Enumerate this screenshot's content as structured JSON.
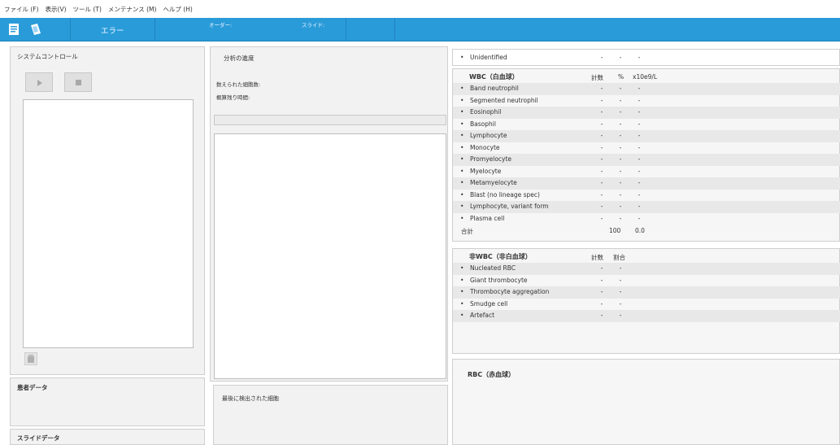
{
  "menu": [
    "ファイル (F)",
    "表示(V)",
    "ツール (T)",
    "メンテナンス (M)",
    "ヘルプ (H)"
  ],
  "toolbar": {
    "error_label": "エラー",
    "order_label": "オーダー:",
    "slide_label": "スライド:"
  },
  "system_control": {
    "title": "システムコントロール"
  },
  "patient_data": {
    "title": "患者データ"
  },
  "slide_data": {
    "title": "スライドデータ"
  },
  "analysis": {
    "title": "分析の進度",
    "counted_cells_label": "数えられた細胞数:",
    "remaining_time_label": "概算残り時間:"
  },
  "last_detected": {
    "title": "最後に検出された細胞"
  },
  "unidentified": {
    "name": "Unidentified",
    "v1": "-",
    "v2": "-",
    "v3": "-"
  },
  "wbc": {
    "title": "WBC（白血球）",
    "col_count": "計数",
    "col_percent": "%",
    "col_conc": "x10e9/L",
    "rows": [
      {
        "name": "Band neutrophil",
        "v1": "-",
        "v2": "-",
        "v3": "-"
      },
      {
        "name": "Segmented neutrophil",
        "v1": "-",
        "v2": "-",
        "v3": "-"
      },
      {
        "name": "Eosinophil",
        "v1": "-",
        "v2": "-",
        "v3": "-"
      },
      {
        "name": "Basophil",
        "v1": "-",
        "v2": "-",
        "v3": "-"
      },
      {
        "name": "Lymphocyte",
        "v1": "-",
        "v2": "-",
        "v3": "-"
      },
      {
        "name": "Monocyte",
        "v1": "-",
        "v2": "-",
        "v3": "-"
      },
      {
        "name": "Promyelocyte",
        "v1": "-",
        "v2": "-",
        "v3": "-"
      },
      {
        "name": "Myelocyte",
        "v1": "-",
        "v2": "-",
        "v3": "-"
      },
      {
        "name": "Metamyelocyte",
        "v1": "-",
        "v2": "-",
        "v3": "-"
      },
      {
        "name": "Blast (no lineage spec)",
        "v1": "-",
        "v2": "-",
        "v3": "-"
      },
      {
        "name": "Lymphocyte, variant form",
        "v1": "-",
        "v2": "-",
        "v3": "-"
      },
      {
        "name": "Plasma cell",
        "v1": "-",
        "v2": "-",
        "v3": "-"
      }
    ],
    "total_label": "合計",
    "total_percent": "100",
    "total_conc": "0.0"
  },
  "non_wbc": {
    "title": "非WBC（非白血球）",
    "col_count": "計数",
    "col_ratio": "割合",
    "rows": [
      {
        "name": "Nucleated RBC",
        "v1": "-",
        "v2": "-"
      },
      {
        "name": "Giant thrombocyte",
        "v1": "-",
        "v2": "-"
      },
      {
        "name": "Thrombocyte aggregation",
        "v1": "-",
        "v2": "-"
      },
      {
        "name": "Smudge cell",
        "v1": "-",
        "v2": "-"
      },
      {
        "name": "Artefact",
        "v1": "-",
        "v2": "-"
      }
    ]
  },
  "rbc": {
    "title": "RBC（赤血球）"
  },
  "colors": {
    "toolbar": "#2a9bd9",
    "panel": "#f2f2f2",
    "alt_row": "#e8e8e8"
  }
}
